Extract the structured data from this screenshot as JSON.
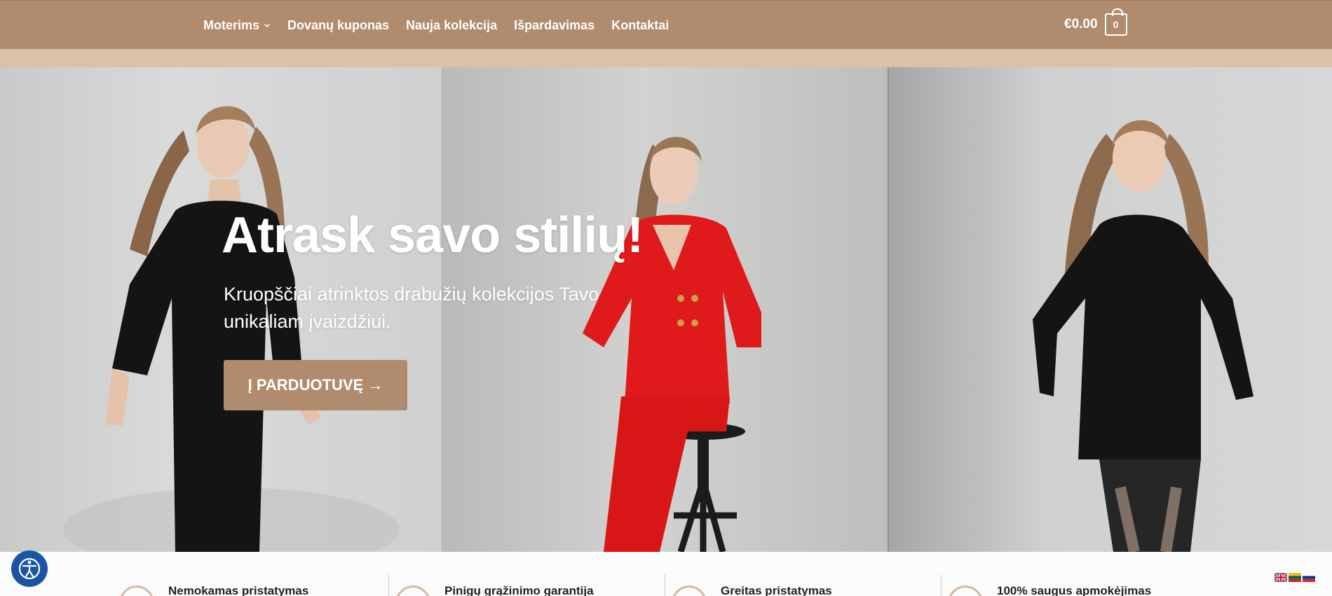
{
  "header": {
    "nav": [
      {
        "label": "Moterims",
        "has_dropdown": true
      },
      {
        "label": "Dovanų kuponas",
        "has_dropdown": false
      },
      {
        "label": "Nauja kolekcija",
        "has_dropdown": false
      },
      {
        "label": "Išpardavimas",
        "has_dropdown": false
      },
      {
        "label": "Kontaktai",
        "has_dropdown": false
      }
    ],
    "cart": {
      "total": "€0.00",
      "count": "0"
    }
  },
  "hero": {
    "title": "Atrask savo stilių!",
    "subtitle": "Kruopščiai atrinktos drabužių kolekcijos Tavo unikaliam įvaizdžiui.",
    "cta_label": "Į PARDUOTUVĘ →"
  },
  "features": [
    {
      "label": "Nemokamas pristatymas"
    },
    {
      "label": "Pinigų grąžinimo garantija"
    },
    {
      "label": "Greitas pristatymas"
    },
    {
      "label": "100% saugus apmokėjimas"
    }
  ],
  "languages": [
    "en-flag-icon",
    "lt-flag-icon",
    "ru-flag-icon"
  ],
  "colors": {
    "brand": "#b08b6d",
    "subbar": "#dcc1a9",
    "accessibility": "#1a55a4",
    "feature_icon_ring": "#d8b9a0"
  }
}
